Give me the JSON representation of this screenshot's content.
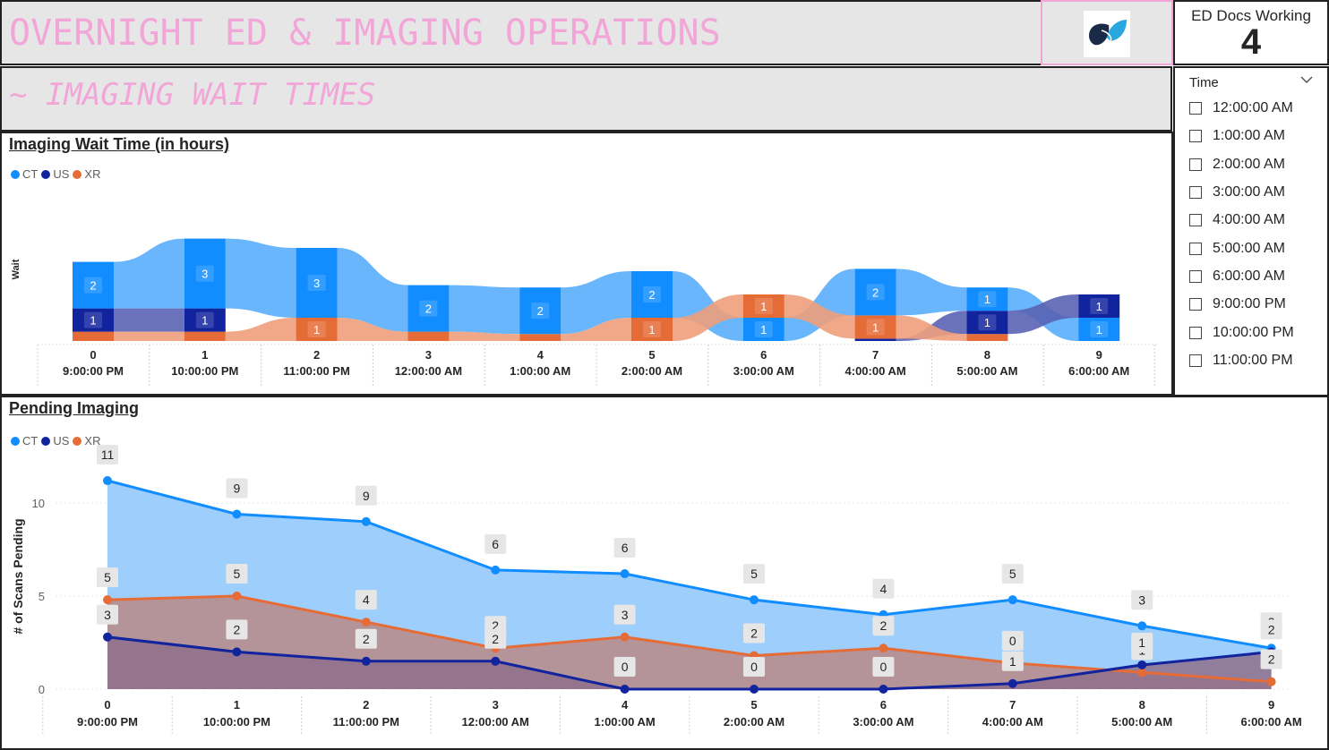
{
  "header": {
    "title": "OVERNIGHT ED & IMAGING OPERATIONS"
  },
  "kpi": {
    "label": "ED Docs Working",
    "value": "4"
  },
  "section": {
    "title": "~ IMAGING WAIT TIMES"
  },
  "slicer": {
    "title": "Time",
    "options": [
      "12:00:00 AM",
      "1:00:00 AM",
      "2:00:00 AM",
      "3:00:00 AM",
      "4:00:00 AM",
      "5:00:00 AM",
      "6:00:00 AM",
      "9:00:00 PM",
      "10:00:00 PM",
      "11:00:00 PM"
    ]
  },
  "colors": {
    "CT": "#118dff",
    "US": "#12239e",
    "XR": "#e66c37",
    "title_pink": "#f2a6d8"
  },
  "chart_data": [
    {
      "type": "ribbon",
      "title": "Imaging Wait Time (in hours)",
      "ylabel": "Wait",
      "legend": [
        "CT",
        "US",
        "XR"
      ],
      "legend_position": "top-left",
      "categories": [
        {
          "index": "0",
          "label": "9:00:00 PM"
        },
        {
          "index": "1",
          "label": "10:00:00 PM"
        },
        {
          "index": "2",
          "label": "11:00:00 PM"
        },
        {
          "index": "3",
          "label": "12:00:00 AM"
        },
        {
          "index": "4",
          "label": "1:00:00 AM"
        },
        {
          "index": "5",
          "label": "2:00:00 AM"
        },
        {
          "index": "6",
          "label": "3:00:00 AM"
        },
        {
          "index": "7",
          "label": "4:00:00 AM"
        },
        {
          "index": "8",
          "label": "5:00:00 AM"
        },
        {
          "index": "9",
          "label": "6:00:00 AM"
        }
      ],
      "series": [
        {
          "name": "CT",
          "values": [
            2,
            3,
            3,
            2,
            2,
            2,
            1,
            2,
            1,
            1
          ]
        },
        {
          "name": "US",
          "values": [
            1,
            1,
            0,
            0,
            0,
            0,
            0,
            0.1,
            1,
            1
          ]
        },
        {
          "name": "XR",
          "values": [
            0.4,
            0.4,
            1,
            0.4,
            0.3,
            1,
            1,
            1,
            0.3,
            0
          ]
        }
      ],
      "stack_order": [
        [
          "XR",
          "US",
          "CT"
        ],
        [
          "XR",
          "US",
          "CT"
        ],
        [
          "XR",
          "CT"
        ],
        [
          "XR",
          "CT"
        ],
        [
          "XR",
          "CT"
        ],
        [
          "XR",
          "CT"
        ],
        [
          "CT",
          "XR"
        ],
        [
          "US",
          "XR",
          "CT"
        ],
        [
          "XR",
          "US",
          "CT"
        ],
        [
          "CT",
          "US"
        ]
      ],
      "data_labels": [
        [
          [
            "CT",
            "2"
          ],
          [
            "US",
            "1"
          ]
        ],
        [
          [
            "CT",
            "3"
          ],
          [
            "US",
            "1"
          ]
        ],
        [
          [
            "CT",
            "3"
          ],
          [
            "XR",
            "1"
          ]
        ],
        [
          [
            "CT",
            "2"
          ]
        ],
        [
          [
            "CT",
            "2"
          ]
        ],
        [
          [
            "CT",
            "2"
          ],
          [
            "XR",
            "1"
          ]
        ],
        [
          [
            "XR",
            "1"
          ],
          [
            "CT",
            "1"
          ]
        ],
        [
          [
            "CT",
            "2"
          ],
          [
            "XR",
            "1"
          ]
        ],
        [
          [
            "CT",
            "1"
          ],
          [
            "US",
            "1"
          ]
        ],
        [
          [
            "US",
            "1"
          ],
          [
            "CT",
            "1"
          ]
        ]
      ]
    },
    {
      "type": "area",
      "title": "Pending Imaging",
      "ylabel": "# of Scans Pending",
      "legend": [
        "CT",
        "US",
        "XR"
      ],
      "legend_position": "top-left",
      "ylim": [
        0,
        12
      ],
      "yticks": [
        "0",
        "5",
        "10"
      ],
      "grid": true,
      "categories": [
        {
          "index": "0",
          "label": "9:00:00 PM"
        },
        {
          "index": "1",
          "label": "10:00:00 PM"
        },
        {
          "index": "2",
          "label": "11:00:00 PM"
        },
        {
          "index": "3",
          "label": "12:00:00 AM"
        },
        {
          "index": "4",
          "label": "1:00:00 AM"
        },
        {
          "index": "5",
          "label": "2:00:00 AM"
        },
        {
          "index": "6",
          "label": "3:00:00 AM"
        },
        {
          "index": "7",
          "label": "4:00:00 AM"
        },
        {
          "index": "8",
          "label": "5:00:00 AM"
        },
        {
          "index": "9",
          "label": "6:00:00 AM"
        }
      ],
      "series": [
        {
          "name": "CT",
          "values": [
            11.2,
            9.4,
            9.0,
            6.4,
            6.2,
            4.8,
            4.0,
            4.8,
            3.4,
            2.2
          ],
          "labels": [
            "11",
            "9",
            "9",
            "6",
            "6",
            "5",
            "4",
            "5",
            "3",
            "2"
          ]
        },
        {
          "name": "US",
          "values": [
            2.8,
            2.0,
            1.5,
            1.5,
            0,
            0,
            0,
            0.3,
            1.3,
            2.0
          ],
          "labels": [
            "3",
            "2",
            "2",
            "2",
            "0",
            "0",
            "0",
            "1",
            "1",
            "2"
          ]
        },
        {
          "name": "XR",
          "values": [
            4.8,
            5.0,
            3.6,
            2.2,
            2.8,
            1.8,
            2.2,
            1.4,
            0.9,
            0.4
          ],
          "labels": [
            "5",
            "5",
            "4",
            "2",
            "3",
            "2",
            "2",
            "0",
            "1",
            "2"
          ]
        }
      ]
    }
  ]
}
